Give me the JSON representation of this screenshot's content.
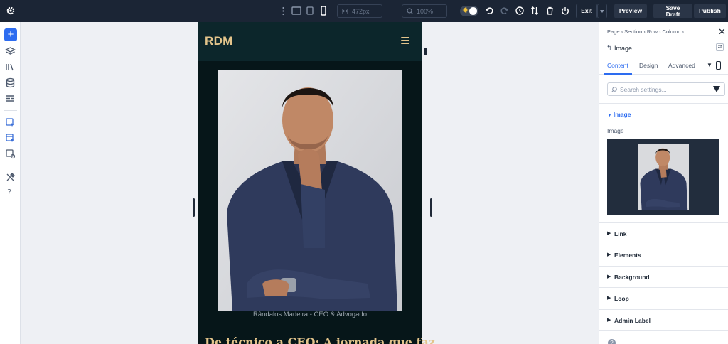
{
  "toolbar": {
    "width_readout": "472px",
    "zoom_readout": "100%",
    "exit_label": "Exit",
    "preview_label": "Preview",
    "save_draft_line1": "Save",
    "save_draft_line2": "Draft",
    "publish_label": "Publish"
  },
  "canvas": {
    "logo_text": "RDM",
    "caption": "Rândalos Madeira - CEO & Advogado",
    "headline": "De técnico a CEO: A jornada que faz"
  },
  "panel": {
    "breadcrumb": "Page  ›  Section  ›  Row  ›  Column  ›...",
    "title": "Image",
    "tabs": [
      "Content",
      "Design",
      "Advanced"
    ],
    "search_placeholder": "Search settings...",
    "open_section": "Image",
    "field_label": "Image",
    "collapsed_sections": [
      "Link",
      "Elements",
      "Background",
      "Loop",
      "Admin Label"
    ]
  },
  "colors": {
    "toolbar_bg": "#1b2535",
    "accent": "#2d6cf0",
    "phone_bg": "#061619",
    "gold": "#e3c48b"
  }
}
